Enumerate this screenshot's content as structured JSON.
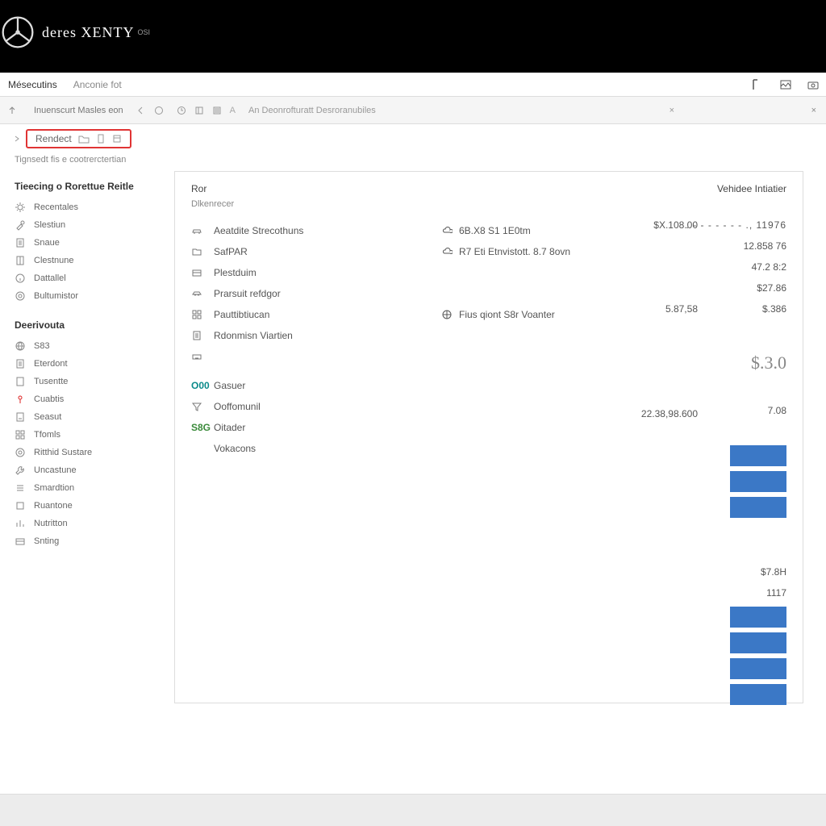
{
  "header": {
    "brand": "deres XENTY",
    "sub": "OSI"
  },
  "menubar": {
    "tabs": [
      "Mésecutins",
      "Anconie fot"
    ]
  },
  "toolbar": {
    "crumb": "Inuenscurt Masles eon",
    "label": "An Deonrofturatt Desroranubiles"
  },
  "secondary": {
    "label": "Rendect"
  },
  "caption": "Tignsedt fis e cootrerctertian",
  "sidebar": {
    "section1": {
      "title": "Tieecing o Rorettue Reitle",
      "items": [
        {
          "icon": "gear",
          "label": "Recentales"
        },
        {
          "icon": "tool",
          "label": "Slestiun"
        },
        {
          "icon": "doc",
          "label": "Snaue"
        },
        {
          "icon": "book",
          "label": "Clestnune"
        },
        {
          "icon": "info",
          "label": "Dattallel"
        },
        {
          "icon": "cog",
          "label": "Bultumistor"
        }
      ]
    },
    "section2": {
      "title": "Deerivouta",
      "items": [
        {
          "icon": "net",
          "label": "S83"
        },
        {
          "icon": "doc",
          "label": "Eterdont"
        },
        {
          "icon": "page",
          "label": "Tusentte"
        },
        {
          "icon": "pin",
          "label": "Cuabtis",
          "red": true
        },
        {
          "icon": "file",
          "label": "Seasut"
        },
        {
          "icon": "grid",
          "label": "Tfomls"
        },
        {
          "icon": "ring",
          "label": "Ritthid Sustare"
        },
        {
          "icon": "wrench",
          "label": "Uncastune"
        },
        {
          "icon": "list",
          "label": "Smardtion"
        },
        {
          "icon": "box",
          "label": "Ruantone"
        },
        {
          "icon": "chart",
          "label": "Nutritton"
        },
        {
          "icon": "card",
          "label": "Snting"
        }
      ]
    }
  },
  "panel": {
    "topLeft": "Ror",
    "topRight": "Vehidee Intiatier",
    "sub": "Dlkenrecer",
    "rows": [
      {
        "icon": "car",
        "label": "Aeatdite Strecothuns",
        "midIcon": "cloud",
        "mid": "6B.X8 S1 1E0tm"
      },
      {
        "icon": "folder",
        "label": "SafPAR",
        "midIcon": "cloud",
        "mid": "R7 Eti Etnvistott. 8.7 8ovn"
      },
      {
        "icon": "card",
        "label": "Plestduim"
      },
      {
        "icon": "car2",
        "label": "Prarsuit refdgor"
      },
      {
        "icon": "grid",
        "label": "Pauttibtiucan",
        "midIcon": "globe",
        "mid": "Fius qiont S8r Voanter"
      },
      {
        "icon": "doc",
        "label": "Rdonmisn Viartien"
      },
      {
        "icon": "kbd",
        "label": ""
      }
    ],
    "extra": [
      {
        "code": "O00",
        "label": "Gasuer",
        "cls": "teal"
      },
      {
        "icon": "filter",
        "label": "Ooffomunil"
      },
      {
        "code": "S8G",
        "label": "Oitader",
        "cls": "green"
      },
      {
        "label": "Vokacons"
      }
    ],
    "col2": [
      "$X.108.00",
      "",
      "",
      "",
      "5.87,58",
      "",
      "",
      "",
      "",
      "22.38,98.600"
    ],
    "vals": [
      ". - - - - - - - ., 11976",
      "12.858 76",
      "47.2 8:2",
      "$27.86",
      "$.386",
      "",
      "",
      "7.08",
      "",
      "",
      "$7.8H",
      "1117"
    ],
    "big": "$.3.0"
  }
}
